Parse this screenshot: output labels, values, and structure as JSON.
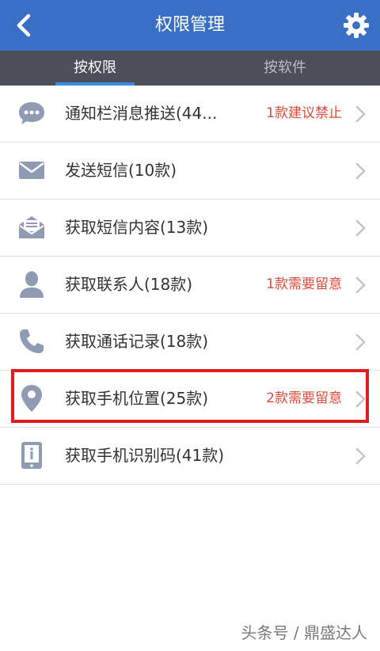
{
  "header": {
    "title": "权限管理",
    "back_icon": "chevron-left-icon",
    "settings_icon": "gear-icon"
  },
  "tabs": [
    {
      "label": "按权限",
      "active": true
    },
    {
      "label": "按软件",
      "active": false
    }
  ],
  "permissions": [
    {
      "icon": "chat-bubble-icon",
      "label": "通知栏消息推送(44...",
      "warning": "1款建议禁止"
    },
    {
      "icon": "envelope-icon",
      "label": "发送短信(10款)",
      "warning": ""
    },
    {
      "icon": "open-envelope-icon",
      "label": "获取短信内容(13款)",
      "warning": ""
    },
    {
      "icon": "person-icon",
      "label": "获取联系人(18款)",
      "warning": "1款需要留意"
    },
    {
      "icon": "phone-icon",
      "label": "获取通话记录(18款)",
      "warning": ""
    },
    {
      "icon": "location-pin-icon",
      "label": "获取手机位置(25款)",
      "warning": "2款需要留意",
      "highlighted": true
    },
    {
      "icon": "phone-id-icon",
      "label": "获取手机识别码(41款)",
      "warning": ""
    }
  ],
  "watermark": "头条号 / 鼎盛达人",
  "colors": {
    "header": "#3a6fc6",
    "tabbar": "#4a4f59",
    "tab_indicator": "#3a8dde",
    "warning": "#e04a3a",
    "highlight_box": "#e01c1c",
    "icon": "#8e9bb3"
  }
}
